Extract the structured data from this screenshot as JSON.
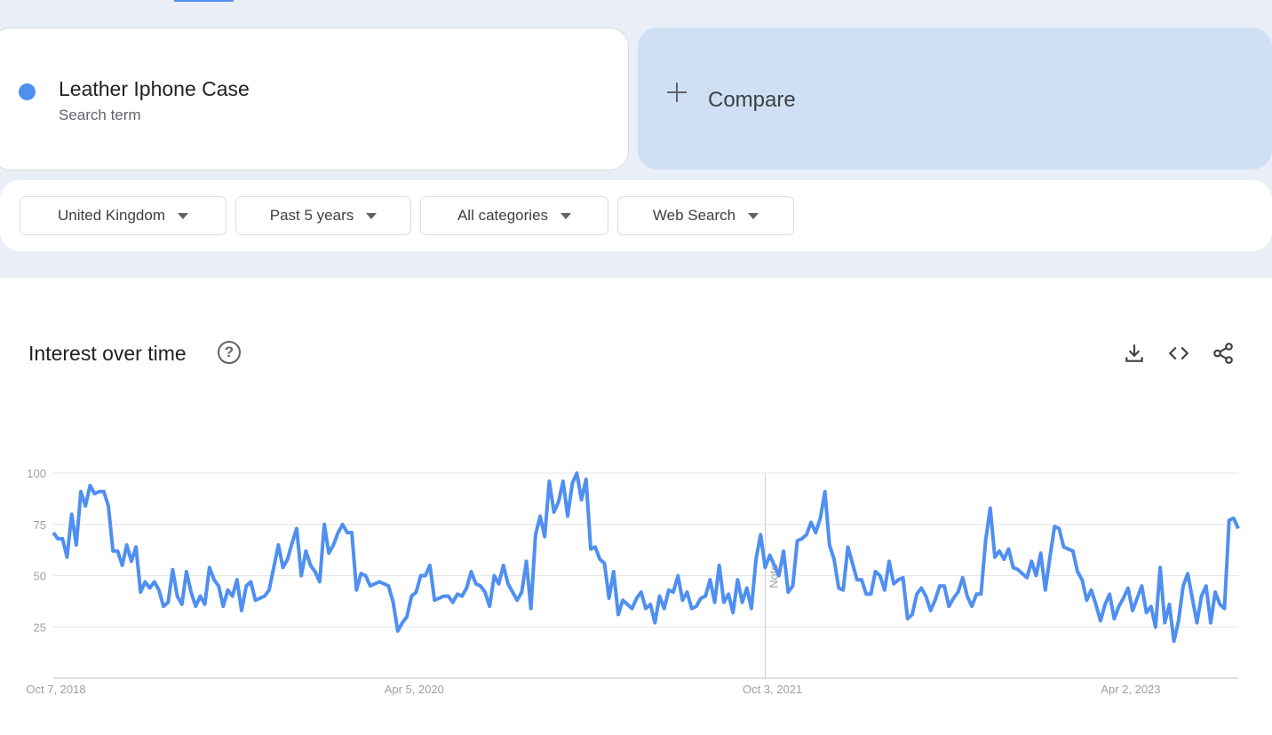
{
  "search_term": {
    "name": "Leather Iphone Case",
    "type": "Search term",
    "color": "#4f8ff2"
  },
  "compare": {
    "label": "Compare"
  },
  "filters": [
    {
      "label": "United Kingdom"
    },
    {
      "label": "Past 5 years"
    },
    {
      "label": "All categories"
    },
    {
      "label": "Web Search"
    }
  ],
  "chart": {
    "title": "Interest over time",
    "note_label": "Note"
  },
  "toolbar_icons": [
    "download-icon",
    "embed-code-icon",
    "share-icon"
  ],
  "chart_data": {
    "type": "line",
    "color": "#4f8ff2",
    "x_tick_labels": [
      "Oct 7, 2018",
      "Apr 5, 2020",
      "Oct 3, 2021",
      "Apr 2, 2023"
    ],
    "y_ticks": [
      25,
      50,
      75,
      100
    ],
    "ylim": [
      0,
      100
    ],
    "grid": true,
    "start_date": "2018-10-07",
    "interval_weeks": 1,
    "note_week_index": 155,
    "values": [
      71,
      68,
      68,
      59,
      80,
      65,
      91,
      84,
      94,
      90,
      91,
      91,
      84,
      62,
      62,
      55,
      65,
      57,
      64,
      42,
      47,
      44,
      47,
      43,
      35,
      37,
      53,
      40,
      36,
      52,
      42,
      35,
      40,
      36,
      54,
      48,
      45,
      35,
      43,
      40,
      48,
      33,
      45,
      47,
      38,
      39,
      40,
      43,
      54,
      65,
      54,
      58,
      66,
      73,
      50,
      62,
      55,
      52,
      47,
      75,
      61,
      65,
      71,
      75,
      71,
      71,
      43,
      51,
      50,
      45,
      46,
      47,
      46,
      45,
      37,
      23,
      27,
      30,
      40,
      42,
      50,
      50,
      55,
      38,
      39,
      40,
      40,
      37,
      41,
      40,
      44,
      52,
      46,
      45,
      42,
      35,
      50,
      46,
      55,
      46,
      42,
      38,
      42,
      57,
      34,
      70,
      79,
      69,
      96,
      81,
      86,
      96,
      79,
      95,
      100,
      87,
      97,
      63,
      64,
      58,
      56,
      39,
      52,
      31,
      38,
      36,
      34,
      39,
      42,
      34,
      36,
      27,
      40,
      34,
      43,
      42,
      50,
      38,
      42,
      34,
      35,
      39,
      40,
      48,
      37,
      55,
      37,
      41,
      32,
      48,
      37,
      44,
      34,
      58,
      70,
      54,
      60,
      55,
      50,
      62,
      42,
      45,
      67,
      68,
      70,
      76,
      71,
      78,
      91,
      65,
      58,
      44,
      43,
      64,
      56,
      48,
      48,
      41,
      41,
      52,
      50,
      43,
      57,
      46,
      48,
      49,
      29,
      31,
      41,
      44,
      40,
      33,
      38,
      45,
      45,
      35,
      39,
      42,
      49,
      40,
      35,
      41,
      41,
      67,
      83,
      59,
      62,
      58,
      63,
      54,
      53,
      51,
      49,
      57,
      50,
      61,
      43,
      59,
      74,
      73,
      64,
      63,
      62,
      52,
      48,
      38,
      43,
      36,
      28,
      36,
      41,
      29,
      35,
      39,
      44,
      33,
      39,
      45,
      32,
      35,
      25,
      54,
      27,
      36,
      18,
      28,
      45,
      51,
      39,
      27,
      40,
      45,
      27,
      42,
      36,
      34,
      77,
      78,
      73
    ]
  }
}
